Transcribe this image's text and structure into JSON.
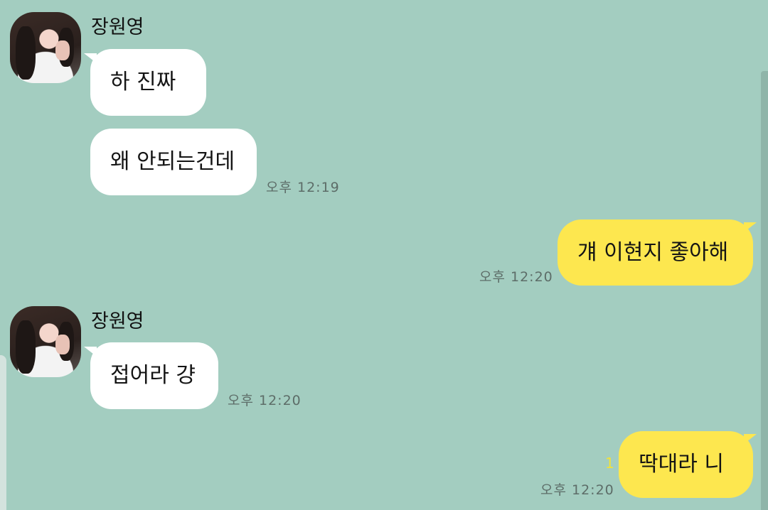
{
  "sender_name": "장원영",
  "messages": {
    "m1": "하 진짜",
    "m2": "왜 안되는건데",
    "m3": "걔 이현지 좋아해",
    "m4": "접어라 걍",
    "m5": "딱대라 니"
  },
  "times": {
    "t1": "오후 12:19",
    "t2": "오후 12:20",
    "t3": "오후 12:20",
    "t4": "오후 12:20"
  },
  "unread_count": "1",
  "colors": {
    "background": "#a3cdc0",
    "incoming_bubble": "#ffffff",
    "outgoing_bubble": "#fde74f"
  }
}
